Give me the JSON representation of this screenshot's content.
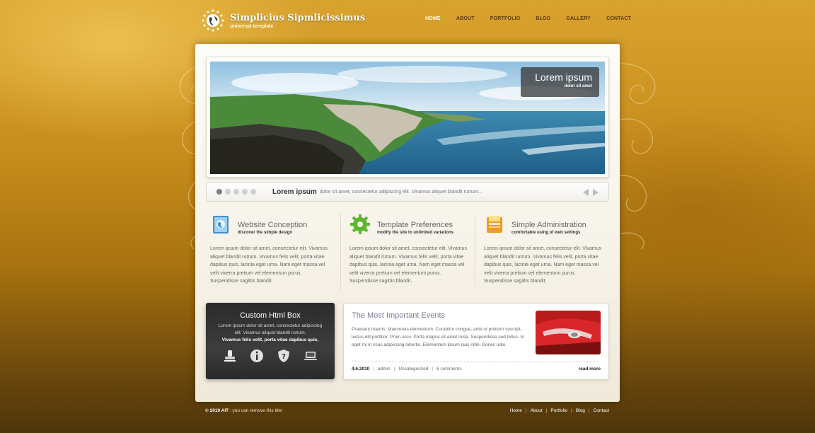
{
  "site": {
    "title": "Simplicius Sipmlicissimus",
    "tagline": "universal template"
  },
  "nav": [
    {
      "label": "HOME"
    },
    {
      "label": "ABOUT"
    },
    {
      "label": "PORTFOLIO"
    },
    {
      "label": "BLOG"
    },
    {
      "label": "GALLERY"
    },
    {
      "label": "CONTACT"
    }
  ],
  "slider": {
    "caption_title": "Lorem ipsum",
    "caption_sub": "dolor sit amet",
    "bar_title": "Lorem ipsum",
    "bar_text": "dolor sit amet, consectetur adipiscing elit. Vivamus aliquet blandit rutrum..."
  },
  "features": [
    {
      "title": "Website Conception",
      "subtitle": "discover the simple design",
      "body": "Lorem ipsum dolor sit amet, consectetur elit. Vivamus aliquet blandit rutrum. Vivamus felis velit, porta vitae dapibus quis, lacinia eget urna. Nam eget massa vel velit viverra pretium vel elementum purus. Suspendisse sagittis blandit.",
      "icon": "book-icon"
    },
    {
      "title": "Template Preferences",
      "subtitle": "modify the site to unlimited variations",
      "body": "Lorem ipsum dolor sit amet, consectetur elit. Vivamus aliquet blandit rutrum. Vivamus felis velit, porta vitae dapibus quis, lacinia eget urna. Nam eget massa vel velit viverra pretium vel elementum purus. Suspendisse sagittis blandit.",
      "icon": "gear-icon"
    },
    {
      "title": "Simple Administration",
      "subtitle": "comfortable using of web settings",
      "body": "Lorem ipsum dolor sit amet, consectetur elit. Vivamus aliquet blandit rutrum. Vivamus felis velit, porta vitae dapibus quis, lacinia eget urna. Nam eget massa vel velit viverra pretium vel elementum purus. Suspendisse sagittis blandit.",
      "icon": "folder-icon"
    }
  ],
  "custom_box": {
    "title": "Custom Html Box",
    "text": "Lorem ipsum dolor sit amet, consectetur adipiscing elit. Vivamus aliquet blandit rutrum.",
    "strong": "Vivamus felis velit, porta vitae dapibus quis,"
  },
  "events": {
    "title": "The Most Important Events",
    "body": "Praesent mauris. Maecenas elementum. Curabitur congue, ante ut pretium suscipit, lectus elit porttitor. Proin arcu. Porta magna sit amet nulla. Suspendisse sed tellus. In eget mi in risus adipiscing lobortis. Elementum ipsum quis nibh. Donec odio.",
    "date": "4.6.2010",
    "author": "admin",
    "category": "Uncategorized",
    "comments": "6 comments",
    "read_more": "read more"
  },
  "footer": {
    "copyright": "© 2010 AIT",
    "note": ": you can remove this title",
    "links": [
      {
        "label": "Home"
      },
      {
        "label": "About"
      },
      {
        "label": "Portfolio"
      },
      {
        "label": "Blog"
      },
      {
        "label": "Contact"
      }
    ]
  },
  "colors": {
    "accent": "#d9a22e",
    "nav_text": "#5a3a08",
    "panel": "#fdfcf8"
  }
}
